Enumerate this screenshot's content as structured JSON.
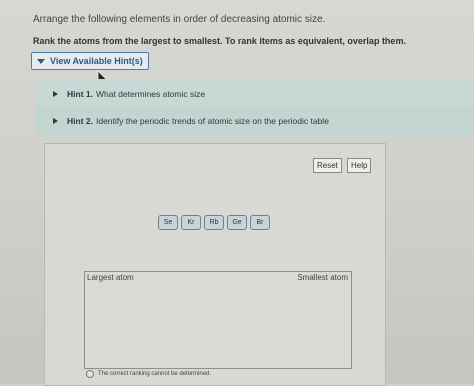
{
  "question": "Arrange the following elements in order of decreasing atomic size.",
  "instruction": "Rank the atoms from the largest to smallest. To rank items as equivalent, overlap them.",
  "hints_toggle": "View Available Hint(s)",
  "hints": [
    {
      "label": "Hint 1.",
      "text": "What determines atomic size"
    },
    {
      "label": "Hint 2.",
      "text": "Identify the periodic trends of atomic size on the periodic table"
    }
  ],
  "buttons": {
    "reset": "Reset",
    "help": "Help"
  },
  "elements": [
    "Se",
    "Kr",
    "Rb",
    "Ge",
    "Br"
  ],
  "ranking": {
    "largest_label": "Largest atom",
    "smallest_label": "Smallest atom"
  },
  "cannot_determine": "The correct ranking cannot be determined."
}
